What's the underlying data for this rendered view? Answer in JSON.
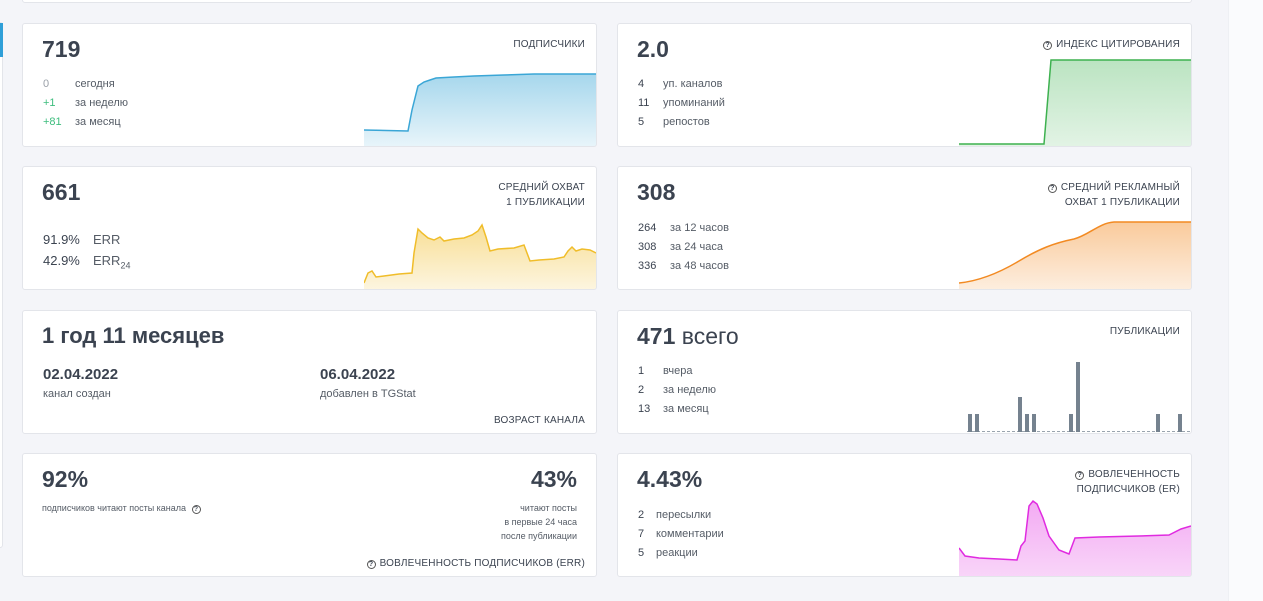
{
  "subscribers": {
    "value": "719",
    "title": "ПОДПИСЧИКИ",
    "stats": [
      {
        "n": "0",
        "label": "сегодня"
      },
      {
        "n": "+1",
        "label": "за неделю"
      },
      {
        "n": "+81",
        "label": "за месяц"
      }
    ],
    "color": "#3aa6d6"
  },
  "citation": {
    "value": "2.0",
    "title": "ИНДЕКС ЦИТИРОВАНИЯ",
    "stats": [
      {
        "n": "4",
        "label": "уп. каналов"
      },
      {
        "n": "11",
        "label": "упоминаний"
      },
      {
        "n": "5",
        "label": "репостов"
      }
    ],
    "color": "#3db14f"
  },
  "reach": {
    "value": "661",
    "title_line1": "СРЕДНИЙ ОХВАТ",
    "title_line2": "1 ПУБЛИКАЦИИ",
    "err": {
      "n": "91.9%",
      "label": "ERR"
    },
    "err24": {
      "n": "42.9%",
      "label": "ERR",
      "sub": "24"
    },
    "color": "#f0bd2a"
  },
  "ad_reach": {
    "value": "308",
    "title_line1": "СРЕДНИЙ РЕКЛАМНЫЙ",
    "title_line2": "ОХВАТ 1 ПУБЛИКАЦИИ",
    "stats": [
      {
        "n": "264",
        "label": "за 12 часов"
      },
      {
        "n": "308",
        "label": "за 24 часа"
      },
      {
        "n": "336",
        "label": "за 48 часов"
      }
    ],
    "color": "#f28a22"
  },
  "age": {
    "value": "1 год 11 месяцев",
    "created_date": "02.04.2022",
    "created_label": "канал создан",
    "added_date": "06.04.2022",
    "added_label": "добавлен в TGStat",
    "title": "ВОЗРАСТ КАНАЛА"
  },
  "publications": {
    "value": "471",
    "suffix": "всего",
    "title": "ПУБЛИКАЦИИ",
    "stats": [
      {
        "n": "1",
        "label": "вчера"
      },
      {
        "n": "2",
        "label": "за неделю"
      },
      {
        "n": "13",
        "label": "за месяц"
      }
    ],
    "color": "#75828f"
  },
  "readers": {
    "left_value": "92%",
    "left_note": "подписчиков читают посты канала",
    "right_value": "43%",
    "right_note_1": "читают посты",
    "right_note_2": "в первые 24 часа",
    "right_note_3": "после публикации",
    "title": "ВОВЛЕЧЕННОСТЬ ПОДПИСЧИКОВ (ERR)"
  },
  "engagement": {
    "value": "4.43%",
    "title_line1": "ВОВЛЕЧЕННОСТЬ",
    "title_line2": "ПОДПИСЧИКОВ (ER)",
    "stats": [
      {
        "n": "2",
        "label": "пересылки"
      },
      {
        "n": "7",
        "label": "комментарии"
      },
      {
        "n": "5",
        "label": "реакции"
      }
    ],
    "color": "#e02be0"
  },
  "icons": {
    "help": "help-circle-icon",
    "help_glyph": "?"
  }
}
